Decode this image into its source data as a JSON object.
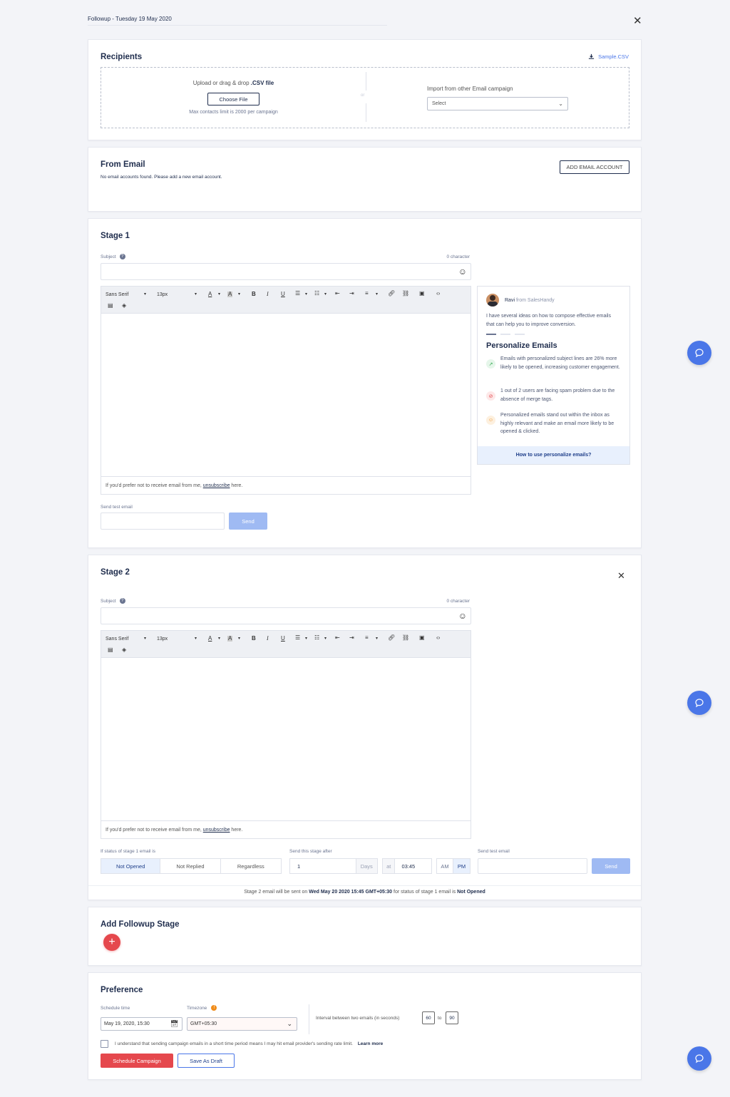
{
  "header": {
    "title": "Followup - Tuesday 19 May 2020"
  },
  "recipients": {
    "title": "Recipients",
    "sample_csv": "Sample.CSV",
    "upload_prefix": "Upload or drag & drop ",
    "upload_file": ".CSV file",
    "choose_file": "Choose File",
    "limit": "Max contacts limit is 2000 per campaign",
    "or": "or",
    "import_label": "Import from other Email campaign",
    "import_select": "Select"
  },
  "from_email": {
    "title": "From Email",
    "message": "No email accounts found. Please add a new email account.",
    "add_button": "ADD EMAIL ACCOUNT"
  },
  "editor_toolbar": {
    "font": "Sans Serif",
    "size": "13px"
  },
  "stage1": {
    "title": "Stage 1",
    "subject_label": "Subject",
    "char_count": "0 character",
    "footer_prefix": "If you'd prefer not to receive email from me, ",
    "footer_link": "unsubscribe",
    "footer_suffix": " here.",
    "test_label": "Send test email",
    "send": "Send"
  },
  "tips": {
    "author": "Ravi",
    "author_suffix": " from SalesHandy",
    "intro": "I have several ideas on how to compose effective emails that can help you to improve conversion.",
    "title": "Personalize Emails",
    "items": [
      {
        "text": "Emails with personalized subject lines are 26% more likely to be opened, increasing customer engagement.",
        "color": "#2fa84f",
        "bg": "#e6f6ea"
      },
      {
        "text": "1 out of 2 users are facing spam problem due to the absence of merge tags.",
        "color": "#e5484d",
        "bg": "#fde8e8"
      },
      {
        "text": "Personalized emails stand out within the inbox as highly relevant and make an email more likely to be opened & clicked.",
        "color": "#f08c1a",
        "bg": "#fdf0df"
      }
    ],
    "link": "How to use personalize emails?"
  },
  "stage2": {
    "title": "Stage 2",
    "subject_label": "Subject",
    "char_count": "0 character",
    "footer_prefix": "If you'd prefer not to receive email from me, ",
    "footer_link": "unsubscribe",
    "footer_suffix": " here.",
    "status_label": "If status of stage 1 email is",
    "status_options": [
      "Not Opened",
      "Not Replied",
      "Regardless"
    ],
    "after_label": "Send this stage after",
    "days_value": "1",
    "days_unit": "Days",
    "at": "at",
    "time": "03:45",
    "am": "AM",
    "pm": "PM",
    "test_label": "Send test email",
    "send": "Send",
    "summary_prefix": "Stage 2 email will be sent on ",
    "summary_date": "Wed May 20 2020 15:45 GMT+05:30",
    "summary_mid": " for status of stage 1 email is ",
    "summary_status": "Not Opened"
  },
  "add_followup": {
    "title": "Add Followup Stage"
  },
  "preference": {
    "title": "Preference",
    "schedule_label": "Schedule time",
    "schedule_value": "May 19, 2020, 15:30",
    "timezone_label": "Timezone",
    "timezone_value": "GMT+05:30",
    "interval_label": "Interval between two emails (in seconds)",
    "interval_min": "60",
    "interval_to": "to",
    "interval_max": "90",
    "consent": "I understand that sending campaign emails in a short time period means I may hit email provider's sending rate limit.",
    "learn_more": "Learn more",
    "schedule_button": "Schedule Campaign",
    "draft_button": "Save As Draft"
  },
  "colors": {
    "accent": "#4a76e8",
    "danger": "#e5484d",
    "navy": "#1f2d4d"
  }
}
